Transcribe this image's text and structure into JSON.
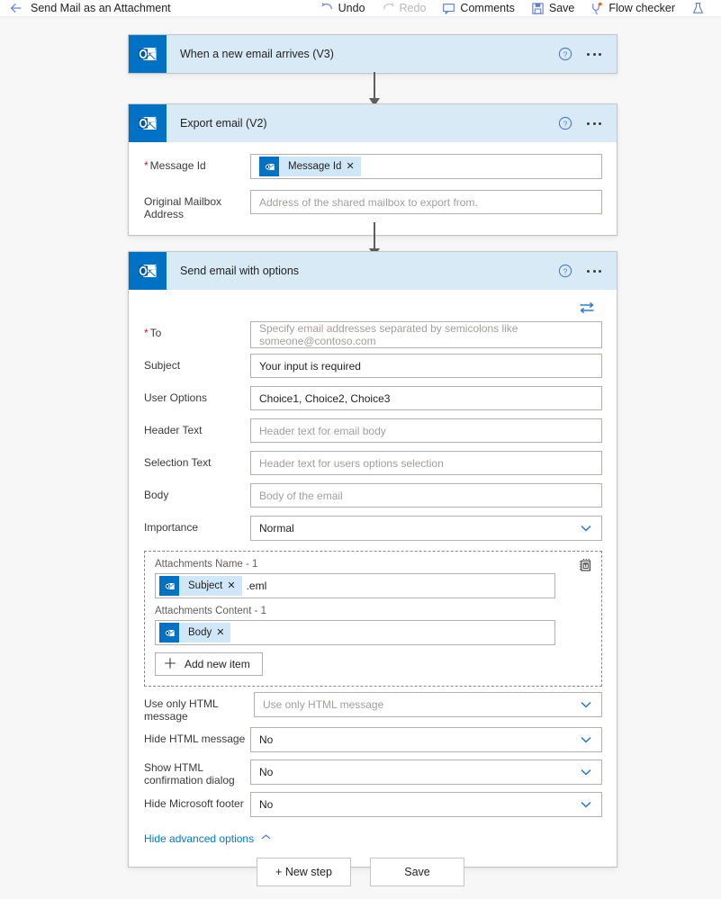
{
  "topbar": {
    "back_icon": "back-arrow-icon",
    "flow_title": "Send Mail as an Attachment",
    "commands": [
      {
        "label": "Undo",
        "icon": "undo-icon",
        "disabled": false
      },
      {
        "label": "Redo",
        "icon": "redo-icon",
        "disabled": true
      },
      {
        "label": "Comments",
        "icon": "comment-icon",
        "disabled": false
      },
      {
        "label": "Save",
        "icon": "save-disk-icon",
        "disabled": false
      },
      {
        "label": "Flow checker",
        "icon": "stethoscope-icon",
        "disabled": false
      },
      {
        "label": "",
        "icon": "beaker-flask-icon",
        "disabled": false
      }
    ]
  },
  "colors": {
    "accent": "#0078d4",
    "outlook_blue": "#0072c6",
    "card_header_bg": "#d9eaf7",
    "token_chip_bg": "#cfe7f7",
    "required_red": "#e81123",
    "canvas_bg": "#f7f7f7",
    "border_gray": "#b3b0ad"
  },
  "steps": [
    {
      "id": "trigger",
      "icon": "outlook-icon",
      "title": "When a new email arrives (V3)",
      "help_icon": "help-circle-icon",
      "menu_icon": "ellipsis-icon",
      "fields": []
    },
    {
      "id": "export-email",
      "icon": "outlook-icon",
      "title": "Export email (V2)",
      "help_icon": "help-circle-icon",
      "menu_icon": "ellipsis-icon",
      "fields": [
        {
          "label": "Message Id",
          "required": true,
          "type": "token",
          "token": {
            "text": "Message Id",
            "icon": "outlook-icon",
            "remove_icon": "close-icon"
          },
          "suffix": ""
        },
        {
          "label": "Original Mailbox Address",
          "required": false,
          "type": "text",
          "value": "",
          "placeholder": "Address of the shared mailbox to export from."
        }
      ]
    },
    {
      "id": "send-email-with-options",
      "icon": "outlook-icon",
      "title": "Send email with options",
      "help_icon": "help-circle-icon",
      "menu_icon": "ellipsis-icon",
      "swap_icon": "swap-arrows-icon",
      "fields": [
        {
          "label": "To",
          "required": true,
          "type": "text",
          "value": "",
          "placeholder": "Specify email addresses separated by semicolons like someone@contoso.com"
        },
        {
          "label": "Subject",
          "required": false,
          "type": "text",
          "value": "Your input is required",
          "placeholder": ""
        },
        {
          "label": "User Options",
          "required": false,
          "type": "text",
          "value": "Choice1, Choice2, Choice3",
          "placeholder": ""
        },
        {
          "label": "Header Text",
          "required": false,
          "type": "text",
          "value": "",
          "placeholder": "Header text for email body"
        },
        {
          "label": "Selection Text",
          "required": false,
          "type": "text",
          "value": "",
          "placeholder": "Header text for users options selection"
        },
        {
          "label": "Body",
          "required": false,
          "type": "text",
          "value": "",
          "placeholder": "Body of the email"
        },
        {
          "label": "Importance",
          "required": false,
          "type": "dropdown",
          "value": "Normal",
          "placeholder": "",
          "chevron_icon": "chevron-down-icon"
        }
      ],
      "attachments": {
        "toolbar_icon": "switch-to-text-mode-icon",
        "items": [
          {
            "label": "Attachments Name - 1",
            "token": {
              "text": "Subject",
              "icon": "outlook-icon",
              "remove_icon": "close-icon"
            },
            "suffix": ".eml"
          },
          {
            "label": "Attachments Content - 1",
            "token": {
              "text": "Body",
              "icon": "outlook-icon",
              "remove_icon": "close-icon"
            },
            "suffix": ""
          }
        ],
        "add_item_label": "Add new item",
        "add_item_icon": "plus-icon"
      },
      "advanced_fields": [
        {
          "label": "Use only HTML message",
          "type": "dropdown",
          "value": "",
          "placeholder": "Use only HTML message",
          "chevron_icon": "chevron-down-icon"
        },
        {
          "label": "Hide HTML message",
          "type": "dropdown",
          "value": "No",
          "placeholder": "",
          "chevron_icon": "chevron-down-icon"
        },
        {
          "label": "Show HTML confirmation dialog",
          "type": "dropdown",
          "value": "No",
          "placeholder": "",
          "chevron_icon": "chevron-down-icon"
        },
        {
          "label": "Hide Microsoft footer",
          "type": "dropdown",
          "value": "No",
          "placeholder": "",
          "chevron_icon": "chevron-down-icon"
        }
      ],
      "advanced_toggle": {
        "label": "Hide advanced options",
        "icon": "chevron-up-icon"
      }
    }
  ],
  "footer": {
    "new_step_label": "+ New step",
    "save_label": "Save"
  }
}
